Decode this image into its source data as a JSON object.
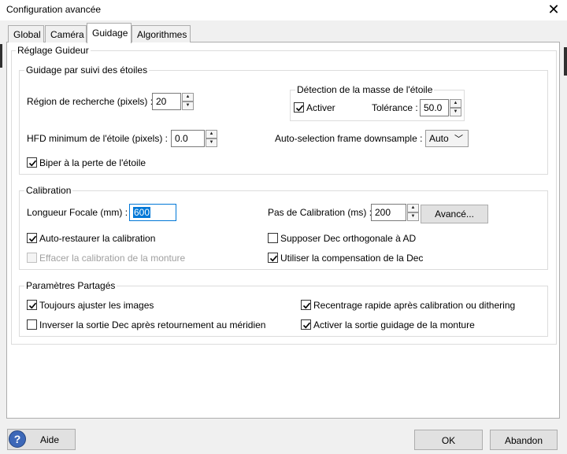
{
  "window": {
    "title": "Configuration avancée",
    "close_glyph": "✕"
  },
  "tabs": [
    {
      "label": "Global"
    },
    {
      "label": "Caméra"
    },
    {
      "label": "Guidage"
    },
    {
      "label": "Algorithmes"
    }
  ],
  "active_tab": "Guidage",
  "guider": {
    "title": "Réglage Guideur",
    "star_tracking": {
      "title": "Guidage par suivi des étoiles",
      "search_region_label": "Région de recherche (pixels) :",
      "search_region_value": "20",
      "min_hfd_label": "HFD minimum de l'étoile (pixels) :",
      "min_hfd_value": "0.0",
      "beep_label": "Biper à la perte de l'étoile",
      "beep_checked": true,
      "mass_detection": {
        "title": "Détection de la masse de l'étoile",
        "enable_label": "Activer",
        "enable_checked": true,
        "tolerance_label": "Tolérance :",
        "tolerance_value": "50.0"
      },
      "downsample_label": "Auto-selection frame downsample :",
      "downsample_value": "Auto"
    },
    "calibration": {
      "title": "Calibration",
      "focal_label": "Longueur Focale (mm) :",
      "focal_value": "600",
      "step_label": "Pas de Calibration (ms) :",
      "step_value": "200",
      "advanced_button": "Avancé...",
      "auto_restore_label": "Auto-restaurer la calibration",
      "auto_restore_checked": true,
      "clear_mount_label": "Effacer la calibration de la monture",
      "clear_mount_checked": false,
      "clear_mount_enabled": false,
      "assume_ortho_label": "Supposer Dec orthogonale à AD",
      "assume_ortho_checked": false,
      "dec_comp_label": "Utiliser la compensation de la Dec",
      "dec_comp_checked": true
    },
    "shared": {
      "title": "Paramètres Partagés",
      "always_scale_label": "Toujours ajuster les images",
      "always_scale_checked": true,
      "reverse_dec_label": "Inverser la sortie Dec après retournement au méridien",
      "reverse_dec_checked": false,
      "fast_recenter_label": "Recentrage rapide après calibration ou dithering",
      "fast_recenter_checked": true,
      "mount_output_label": "Activer la sortie guidage de la monture",
      "mount_output_checked": true
    }
  },
  "footer": {
    "help_button": "Aide",
    "help_icon_glyph": "?",
    "ok_button": "OK",
    "cancel_button": "Abandon"
  },
  "colors": {
    "accent": "#0078d7",
    "help_icon": "#3d68b8",
    "panel_bg": "#ffffff",
    "window_bg": "#f0f0f0"
  }
}
